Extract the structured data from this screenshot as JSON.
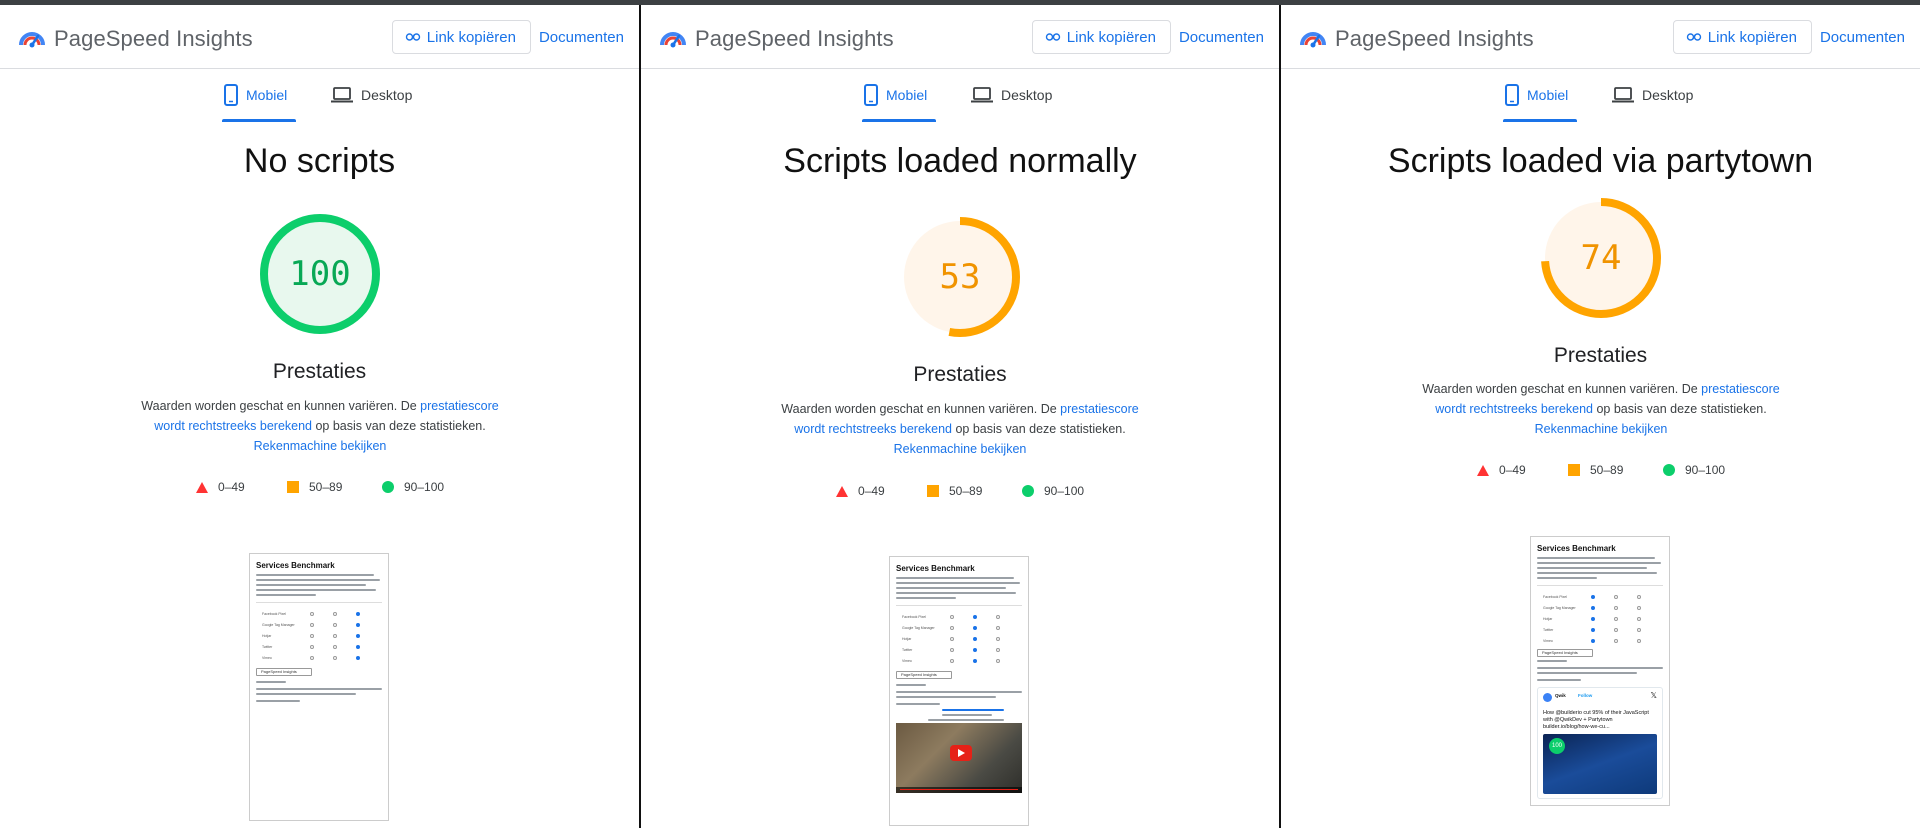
{
  "app": {
    "brand": "PageSpeed Insights",
    "copy_link": "Link kopiëren",
    "docs": "Documenten",
    "tab_mobile": "Mobiel",
    "tab_desktop": "Desktop"
  },
  "panels": [
    {
      "title": "No scripts",
      "score": "100",
      "score_value": 100,
      "rating": "pass",
      "label": "Prestaties"
    },
    {
      "title": "Scripts loaded normally",
      "score": "53",
      "score_value": 53,
      "rating": "average",
      "label": "Prestaties"
    },
    {
      "title": "Scripts loaded via partytown",
      "score": "74",
      "score_value": 74,
      "rating": "average",
      "label": "Prestaties"
    }
  ],
  "desc": {
    "p1": "Waarden worden geschat en kunnen variëren. De ",
    "link1": "prestatiescore wordt rechtstreeks berekend",
    "p2": " op basis van deze statistieken. ",
    "link2": "Rekenmachine bekijken"
  },
  "legend": {
    "fail": "0–49",
    "average": "50–89",
    "pass": "90–100"
  },
  "thumbnail": {
    "title": "Services Benchmark",
    "services": [
      "Facebook Pixel",
      "Google Tag Manager",
      "Hotjar",
      "Twitter",
      "Vimeo"
    ],
    "button": "PageSpeed Insights",
    "tweet_author": "Qwik",
    "tweet_follow": "Follow",
    "tweet_text": "How @builderio cut 95% of their JavaScript with @QwikDev + Partytown builder.io/blog/how-we-cu..."
  },
  "colors": {
    "pass": "#0cce6b",
    "pass_bg": "#e8f8ee",
    "average": "#ffa400",
    "average_bg": "#fff5ea",
    "fail": "#ff3333",
    "link": "#1a73e8"
  },
  "icons": [
    "pagespeed-logo-icon",
    "link-icon",
    "mobile-phone-icon",
    "laptop-icon",
    "fail-triangle-icon",
    "average-square-icon",
    "pass-circle-icon"
  ]
}
